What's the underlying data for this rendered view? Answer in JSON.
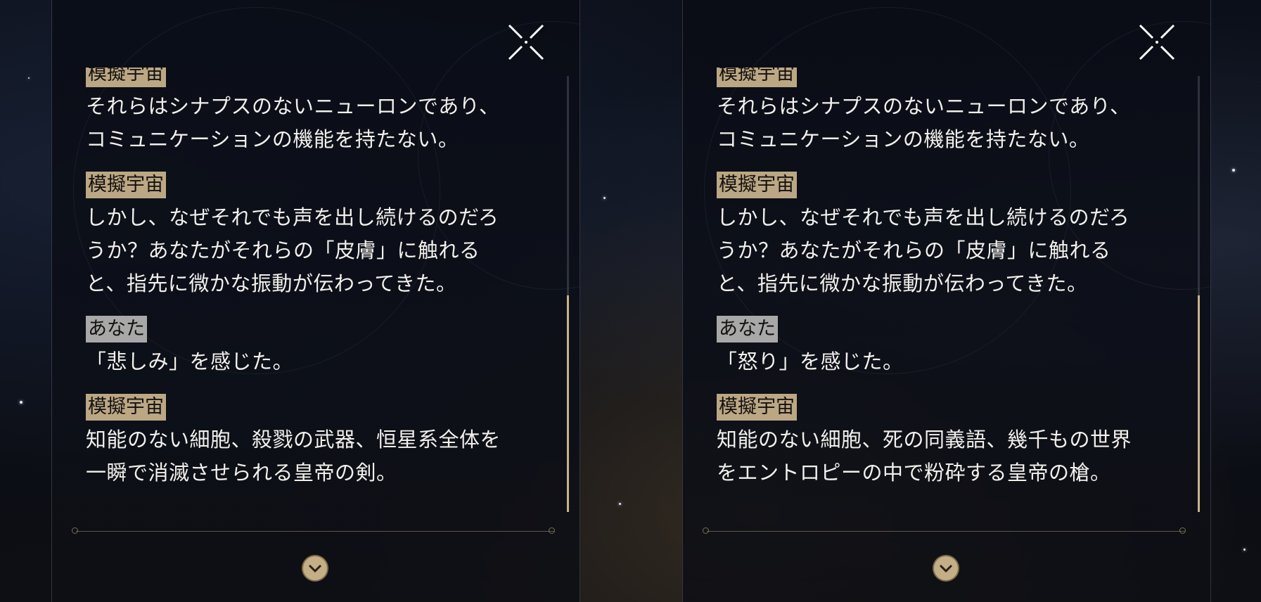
{
  "colors": {
    "npc_tag": "#bca784",
    "player_tag": "#a8a8a8",
    "accent_gold": "#c9b38a",
    "text": "#f2f0ec"
  },
  "left_panel": {
    "close_icon": "close-x-icon",
    "next_icon": "chevron-down-icon",
    "messages": [
      {
        "speaker": "模擬宇宙",
        "role": "npc",
        "text": "それらはシナプスのないニューロンであり、\nコミュニケーションの機能を持たない。"
      },
      {
        "speaker": "模擬宇宙",
        "role": "npc",
        "text": "しかし、なぜそれでも声を出し続けるのだろ\nうか？あなたがそれらの「皮膚」に触れる\nと、指先に微かな振動が伝わってきた。"
      },
      {
        "speaker": "あなた",
        "role": "player",
        "text": "「悲しみ」を感じた。"
      },
      {
        "speaker": "模擬宇宙",
        "role": "npc",
        "text": "知能のない細胞、殺戮の武器、恒星系全体を\n一瞬で消滅させられる皇帝の剣。"
      }
    ],
    "scroll_position": 0.5
  },
  "right_panel": {
    "close_icon": "close-x-icon",
    "next_icon": "chevron-down-icon",
    "messages": [
      {
        "speaker": "模擬宇宙",
        "role": "npc",
        "text": "それらはシナプスのないニューロンであり、\nコミュニケーションの機能を持たない。"
      },
      {
        "speaker": "模擬宇宙",
        "role": "npc",
        "text": "しかし、なぜそれでも声を出し続けるのだろ\nうか？あなたがそれらの「皮膚」に触れる\nと、指先に微かな振動が伝わってきた。"
      },
      {
        "speaker": "あなた",
        "role": "player",
        "text": "「怒り」を感じた。"
      },
      {
        "speaker": "模擬宇宙",
        "role": "npc",
        "text": "知能のない細胞、死の同義語、幾千もの世界\nをエントロピーの中で粉砕する皇帝の槍。"
      }
    ],
    "scroll_position": 0.5
  }
}
